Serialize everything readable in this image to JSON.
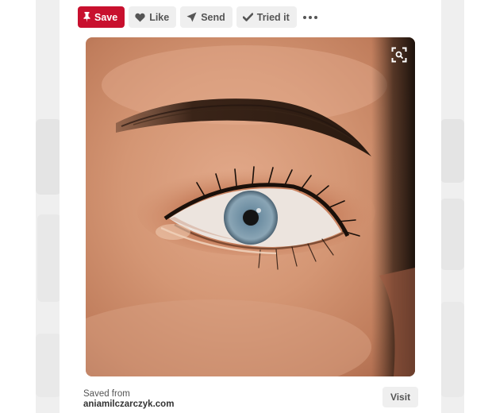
{
  "toolbar": {
    "save_label": "Save",
    "like_label": "Like",
    "send_label": "Send",
    "tried_label": "Tried it",
    "more_icon": "more-horizontal-icon"
  },
  "pin": {
    "image_icon": "visual-search-icon",
    "saved_from_label": "Saved from",
    "source_domain": "aniamilczarczyk.com",
    "visit_label": "Visit"
  },
  "colors": {
    "save_red": "#c8102e",
    "button_grey": "#efefef",
    "text_grey": "#555555"
  }
}
